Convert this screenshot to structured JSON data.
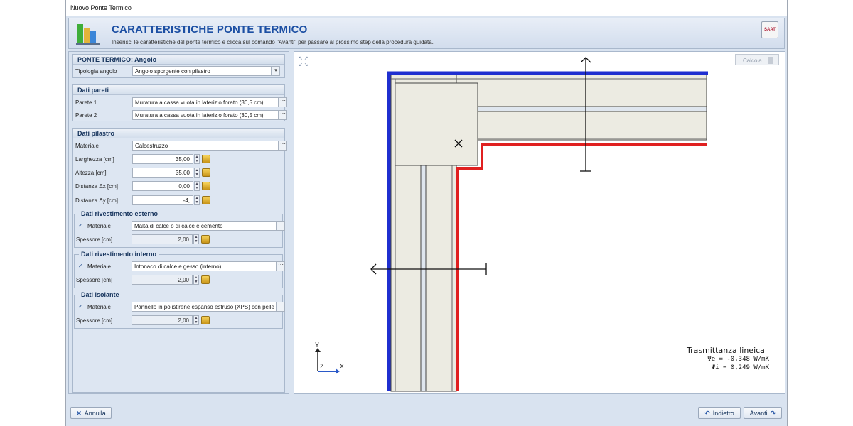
{
  "window": {
    "title": "Nuovo Ponte Termico"
  },
  "header": {
    "title": "CARATTERISTICHE PONTE TERMICO",
    "subtitle": "Inserisci le caratteristiche del ponte termico e clicca sul comando \"Avanti\" per passare al prossimo step della procedura guidata.",
    "brand_label": "SAAT"
  },
  "ponte": {
    "header": "PONTE TERMICO: Angolo",
    "tipologia_label": "Tipologia angolo",
    "tipologia_value": "Angolo sporgente con pilastro"
  },
  "pareti": {
    "header": "Dati pareti",
    "rows": [
      {
        "label": "Parete 1",
        "value": "Muratura a cassa vuota in laterizio forato (30,5 cm)"
      },
      {
        "label": "Parete 2",
        "value": "Muratura a cassa vuota in laterizio forato (30,5 cm)"
      }
    ]
  },
  "pilastro": {
    "header": "Dati pilastro",
    "materiale_label": "Materiale",
    "materiale_value": "Calcestruzzo",
    "rows": [
      {
        "label": "Larghezza [cm]",
        "value": "35,00"
      },
      {
        "label": "Altezza [cm]",
        "value": "35,00"
      },
      {
        "label": "Distanza Δx [cm]",
        "value": "0,00"
      },
      {
        "label": "Distanza Δy [cm]",
        "value": "-4,"
      }
    ],
    "esterno": {
      "header": "Dati rivestimento esterno",
      "materiale_label": "Materiale",
      "materiale_value": "Malta di calce o di calce e cemento",
      "spessore_label": "Spessore [cm]",
      "spessore_value": "2,00"
    },
    "interno": {
      "header": "Dati rivestimento interno",
      "materiale_label": "Materiale",
      "materiale_value": "Intonaco di calce e gesso (interno)",
      "spessore_label": "Spessore [cm]",
      "spessore_value": "2,00"
    },
    "isolante": {
      "header": "Dati isolante",
      "materiale_label": "Materiale",
      "materiale_value": "Pannello in polistirene espanso estruso (XPS) con pelle",
      "spessore_label": "Spessore [cm]",
      "spessore_value": "2,00"
    }
  },
  "canvas": {
    "calcola_label": "Calcola",
    "axis_y": "Y",
    "axis_x": "X",
    "axis_z": "Z",
    "trasmittanza_title": "Trasmittanza lineica",
    "psi_e": "Ψe = -0,348 W/mK",
    "psi_i": "Ψi = 0,249 W/mK",
    "colors": {
      "external_line": "#1f2fd0",
      "internal_line": "#e02020",
      "wall_fill": "#ecebe2"
    }
  },
  "footer": {
    "annulla": "Annulla",
    "indietro": "Indietro",
    "avanti": "Avanti"
  },
  "icons": [
    "app-logo-icon",
    "brand-icon",
    "dropdown-icon",
    "ellipsis-icon",
    "spin-icon",
    "lock-icon",
    "check-icon",
    "expand-icon",
    "calculator-icon",
    "close-icon",
    "back-arrow-icon",
    "forward-arrow-icon"
  ]
}
